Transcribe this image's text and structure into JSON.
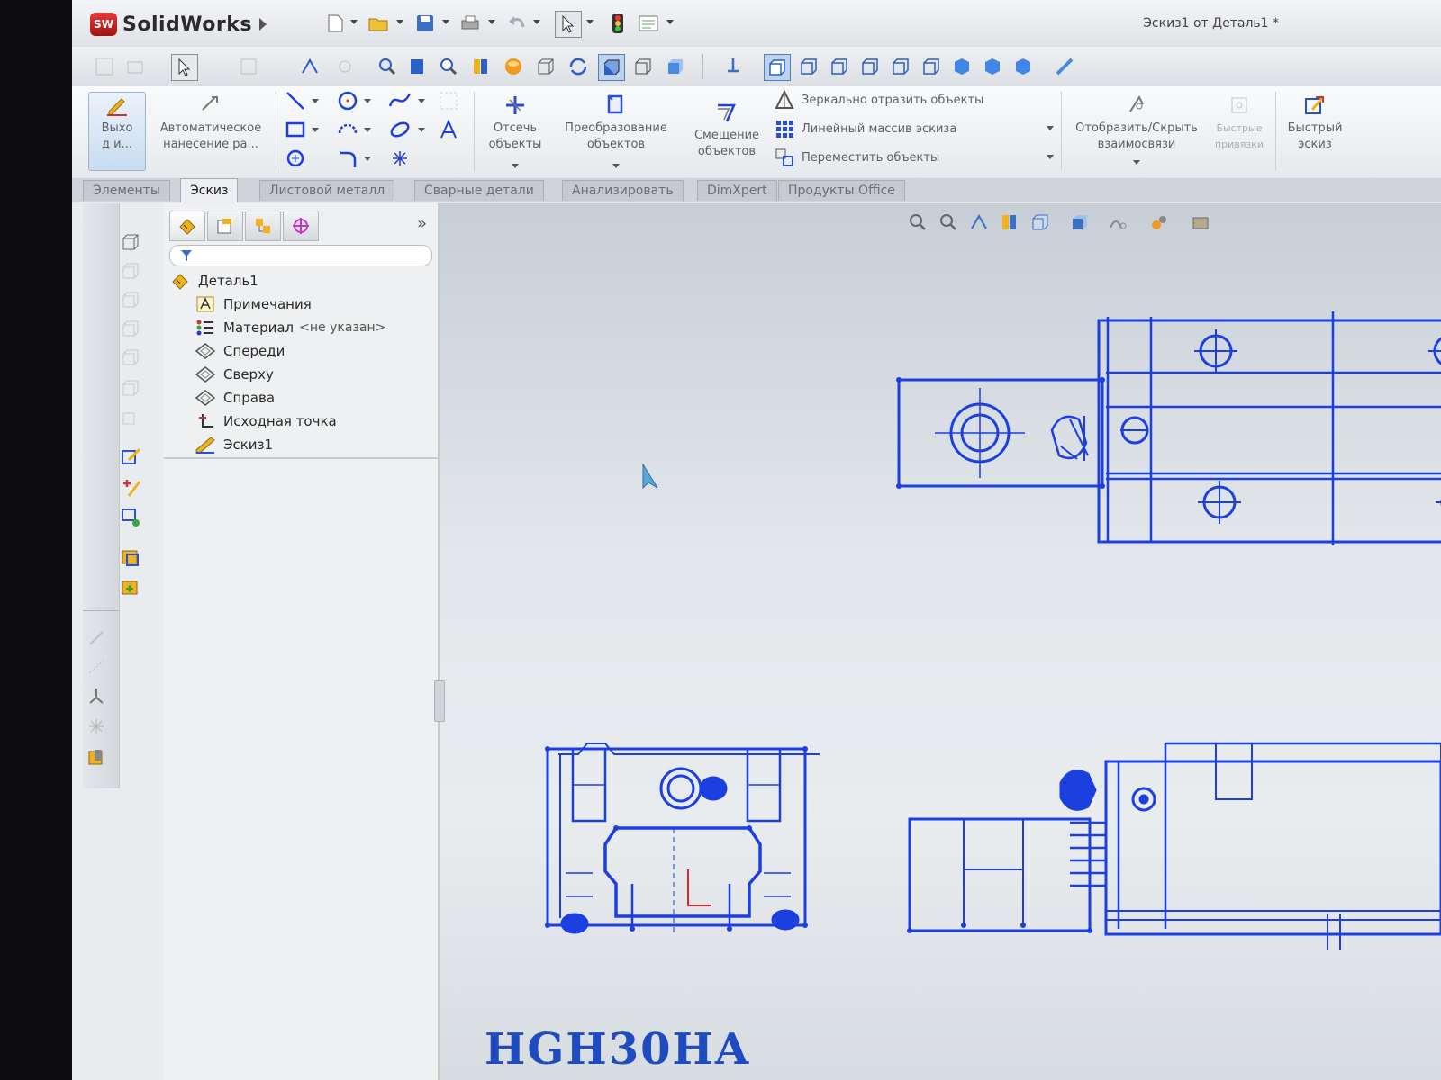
{
  "app": {
    "name": "SolidWorks",
    "logo_mark": "SW"
  },
  "document": {
    "title": "Эскиз1 от Деталь1 *"
  },
  "command_manager": {
    "exit_sketch": "Выхо\nд и...",
    "smart_dimension": "Автоматическое\nнанесение ра...",
    "trim": "Отсечь\nобъекты",
    "convert": "Преобразование\nобъектов",
    "offset": "Смещение\nобъектов",
    "mirror": "Зеркально отразить объекты",
    "linear_pattern": "Линейный массив эскиза",
    "move": "Переместить объекты",
    "display_relations": "Отобразить/Скрыть\nвзаимосвязи",
    "quick_snaps": "Быстрые\nпривязки",
    "rapid_sketch": "Быстрый\nэскиз"
  },
  "tabs": [
    {
      "label": "Элементы",
      "active": false
    },
    {
      "label": "Эскиз",
      "active": true
    },
    {
      "label": "Листовой металл",
      "active": false
    },
    {
      "label": "Сварные детали",
      "active": false
    },
    {
      "label": "Анализировать",
      "active": false
    },
    {
      "label": "DimXpert",
      "active": false
    },
    {
      "label": "Продукты Office",
      "active": false
    }
  ],
  "feature_tree": {
    "root": "Деталь1",
    "items": [
      {
        "label": "Примечания",
        "icon": "annotations-icon"
      },
      {
        "label": "Материал",
        "suffix": "<не указан>",
        "icon": "material-icon"
      },
      {
        "label": "Спереди",
        "icon": "plane-icon"
      },
      {
        "label": "Сверху",
        "icon": "plane-icon"
      },
      {
        "label": "Справа",
        "icon": "plane-icon"
      },
      {
        "label": "Исходная точка",
        "icon": "origin-icon"
      },
      {
        "label": "Эскиз1",
        "icon": "sketch-icon"
      }
    ]
  },
  "graphics": {
    "watermark_text": "HGH30HA"
  },
  "colors": {
    "sketch_blue": "#1c3fe0",
    "tab_active": "#eceef1",
    "accent_red": "#d42a2a"
  }
}
